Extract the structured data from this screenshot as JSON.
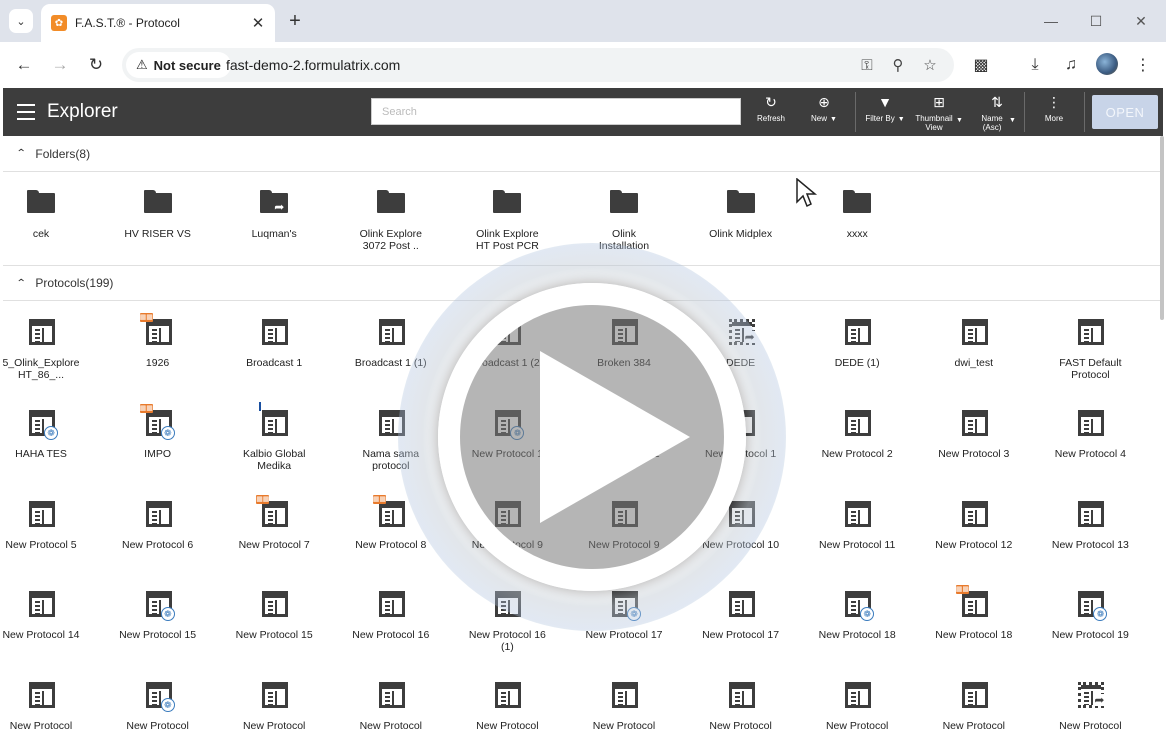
{
  "browser": {
    "tab_title": "F.A.S.T.® - Protocol",
    "security_label": "Not secure",
    "url": "fast-demo-2.formulatrix.com"
  },
  "toolbar": {
    "title": "Explorer",
    "search_placeholder": "Search",
    "refresh": "Refresh",
    "new": "New",
    "filter_by": "Filter By",
    "thumbnail_view": "Thumbnail View",
    "sort_name": "Name (Asc)",
    "more": "More",
    "open": "OPEN"
  },
  "folders": {
    "header": "Folders(8)",
    "items": [
      {
        "name": "cek",
        "shared": false
      },
      {
        "name": "HV RISER VS",
        "shared": false
      },
      {
        "name": "Luqman's",
        "shared": true
      },
      {
        "name": "Olink Explore 3072 Post ..",
        "shared": false
      },
      {
        "name": "Olink Explore HT Post PCR",
        "shared": false
      },
      {
        "name": "Olink Installation",
        "shared": false
      },
      {
        "name": "Olink Midplex",
        "shared": false
      },
      {
        "name": "xxxx",
        "shared": false
      }
    ]
  },
  "protocols": {
    "header": "Protocols(199)",
    "items": [
      {
        "name": "5_Olink_ExploreHT_86_...",
        "badge": ""
      },
      {
        "name": "1926",
        "badge": "book"
      },
      {
        "name": "Broadcast 1",
        "badge": ""
      },
      {
        "name": "Broadcast 1 (1)",
        "badge": ""
      },
      {
        "name": "Broadcast 1 (2)",
        "badge": ""
      },
      {
        "name": "Broken 384",
        "badge": ""
      },
      {
        "name": "DEDE",
        "badge": "share"
      },
      {
        "name": "DEDE (1)",
        "badge": ""
      },
      {
        "name": "dwi_test",
        "badge": ""
      },
      {
        "name": "FAST Default Protocol",
        "badge": ""
      },
      {
        "name": "HAHA TES",
        "badge": "hex"
      },
      {
        "name": "IMPO",
        "badge": "book-hex"
      },
      {
        "name": "Kalbio Global Medika",
        "badge": "pin"
      },
      {
        "name": "Nama sama protocol",
        "badge": ""
      },
      {
        "name": "New Protocol 1",
        "badge": "hex"
      },
      {
        "name": "New Protocol 1",
        "badge": "hex"
      },
      {
        "name": "New Protocol 1",
        "badge": ""
      },
      {
        "name": "New Protocol 2",
        "badge": ""
      },
      {
        "name": "New Protocol 3",
        "badge": ""
      },
      {
        "name": "New Protocol 4",
        "badge": ""
      },
      {
        "name": "New Protocol 5",
        "badge": ""
      },
      {
        "name": "New Protocol 6",
        "badge": ""
      },
      {
        "name": "New Protocol 7",
        "badge": "book"
      },
      {
        "name": "New Protocol 8",
        "badge": "book"
      },
      {
        "name": "New Protocol 9",
        "badge": ""
      },
      {
        "name": "New Protocol 9",
        "badge": ""
      },
      {
        "name": "New Protocol 10",
        "badge": ""
      },
      {
        "name": "New Protocol 11",
        "badge": ""
      },
      {
        "name": "New Protocol 12",
        "badge": ""
      },
      {
        "name": "New Protocol 13",
        "badge": ""
      },
      {
        "name": "New Protocol 14",
        "badge": ""
      },
      {
        "name": "New Protocol 15",
        "badge": "hex"
      },
      {
        "name": "New Protocol 15",
        "badge": ""
      },
      {
        "name": "New Protocol 16",
        "badge": ""
      },
      {
        "name": "New Protocol 16 (1)",
        "badge": ""
      },
      {
        "name": "New Protocol 17",
        "badge": "hex"
      },
      {
        "name": "New Protocol 17",
        "badge": ""
      },
      {
        "name": "New Protocol 18",
        "badge": "hex"
      },
      {
        "name": "New Protocol 18",
        "badge": "book"
      },
      {
        "name": "New Protocol 19",
        "badge": "hex"
      },
      {
        "name": "New Protocol",
        "badge": ""
      },
      {
        "name": "New Protocol",
        "badge": "hex"
      },
      {
        "name": "New Protocol",
        "badge": ""
      },
      {
        "name": "New Protocol",
        "badge": ""
      },
      {
        "name": "New Protocol",
        "badge": ""
      },
      {
        "name": "New Protocol",
        "badge": ""
      },
      {
        "name": "New Protocol",
        "badge": ""
      },
      {
        "name": "New Protocol",
        "badge": ""
      },
      {
        "name": "New Protocol",
        "badge": ""
      },
      {
        "name": "New Protocol",
        "badge": "share"
      }
    ]
  }
}
